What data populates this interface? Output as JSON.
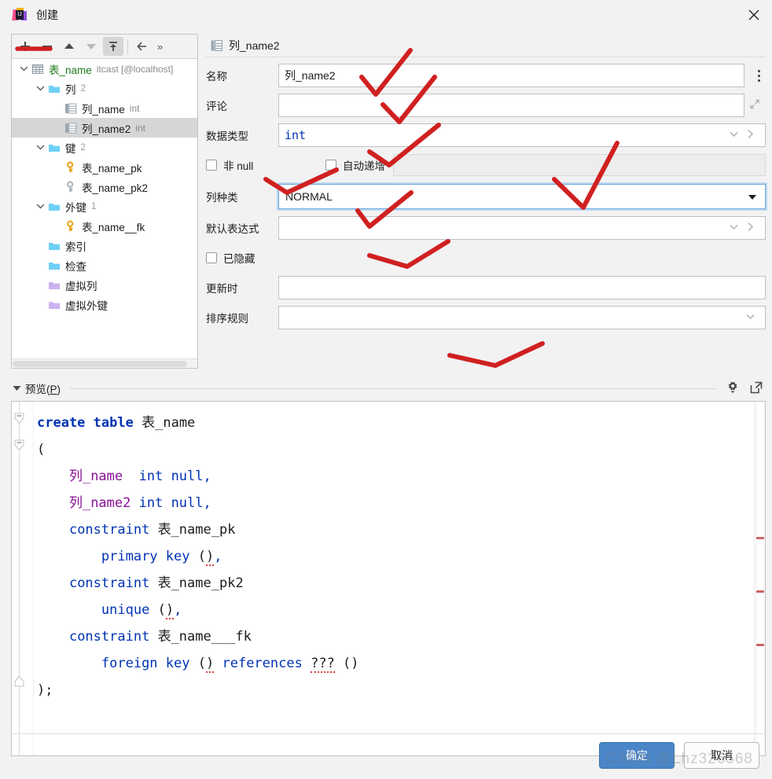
{
  "window": {
    "title": "创建",
    "app_icon": "intellij-idea-icon",
    "close_icon": "close-icon"
  },
  "tree_toolbar": {
    "buttons": [
      {
        "name": "add-button",
        "icon": "plus-icon",
        "label": "+"
      },
      {
        "name": "remove-button",
        "icon": "minus-icon",
        "label": "−"
      },
      {
        "name": "move-up-button",
        "icon": "arrow-up-icon",
        "label": "▲"
      },
      {
        "name": "move-down-button",
        "icon": "arrow-down-icon",
        "label": "▼"
      },
      {
        "name": "move-to-top-button",
        "icon": "upload-icon",
        "label": "⤒",
        "active": true
      },
      {
        "name": "back-button",
        "icon": "arrow-left-icon",
        "label": "←"
      }
    ],
    "overflow_label": "»"
  },
  "tree": {
    "items": [
      {
        "label": "表_name",
        "suffix": "itcast [@localhost]",
        "icon": "table-icon",
        "depth": 0,
        "expanded": true,
        "selected": false,
        "color": "green"
      },
      {
        "label": "列",
        "count": "2",
        "icon": "folder-blue-icon",
        "depth": 1,
        "expanded": true,
        "selected": false,
        "color": "dark"
      },
      {
        "label": "列_name",
        "suffix": "int",
        "icon": "column-icon",
        "depth": 2,
        "expanded": null,
        "selected": false,
        "color": "dark"
      },
      {
        "label": "列_name2",
        "suffix": "int",
        "icon": "column-icon",
        "depth": 2,
        "expanded": null,
        "selected": true,
        "color": "dark"
      },
      {
        "label": "键",
        "count": "2",
        "icon": "folder-blue-icon",
        "depth": 1,
        "expanded": true,
        "selected": false,
        "color": "dark"
      },
      {
        "label": "表_name_pk",
        "icon": "key-gold-icon",
        "depth": 2,
        "expanded": null,
        "selected": false,
        "color": "dark"
      },
      {
        "label": "表_name_pk2",
        "icon": "key-gray-icon",
        "depth": 2,
        "expanded": null,
        "selected": false,
        "color": "dark"
      },
      {
        "label": "外键",
        "count": "1",
        "icon": "folder-blue-icon",
        "depth": 1,
        "expanded": true,
        "selected": false,
        "color": "dark"
      },
      {
        "label": "表_name__fk",
        "icon": "key-gold-icon",
        "depth": 2,
        "expanded": null,
        "selected": false,
        "color": "dark"
      },
      {
        "label": "索引",
        "icon": "folder-blue-icon",
        "depth": 1,
        "expanded": null,
        "selected": false,
        "color": "dark"
      },
      {
        "label": "检查",
        "icon": "folder-blue-icon",
        "depth": 1,
        "expanded": null,
        "selected": false,
        "color": "dark"
      },
      {
        "label": "虚拟列",
        "icon": "folder-purple-icon",
        "depth": 1,
        "expanded": null,
        "selected": false,
        "color": "dark"
      },
      {
        "label": "虚拟外键",
        "icon": "folder-purple-icon",
        "depth": 1,
        "expanded": null,
        "selected": false,
        "color": "dark"
      }
    ]
  },
  "form": {
    "header_title": "列_name2",
    "header_icon": "column-icon",
    "name": {
      "label": "名称",
      "value": "列_name2",
      "kebab_icon": "more-vertical-icon"
    },
    "comment": {
      "label": "评论",
      "value": "",
      "expand_icon": "expand-diagonal-icon"
    },
    "data_type": {
      "label": "数据类型",
      "value": "int",
      "chevron_down_icon": "chevron-down-icon",
      "chevron_right_icon": "chevron-right-icon"
    },
    "not_null": {
      "label": "非 null",
      "checked": false
    },
    "auto_increment": {
      "label": "自动递增",
      "checked": false,
      "value": ""
    },
    "column_kind": {
      "label": "列种类",
      "value": "NORMAL",
      "focused": true,
      "arrow_icon": "triangle-down-icon"
    },
    "default_expression": {
      "label": "默认表达式",
      "value": "",
      "chevron_down_icon": "chevron-down-icon",
      "chevron_right_icon": "chevron-right-icon"
    },
    "hidden": {
      "label": "已隐藏",
      "checked": false
    },
    "on_update": {
      "label": "更新时",
      "value": ""
    },
    "collation": {
      "label": "排序规则",
      "value": "",
      "chevron_down_icon": "chevron-down-icon"
    }
  },
  "preview": {
    "title_prefix": "预览(",
    "mnemonic": "P",
    "title_suffix": ")",
    "twisty_icon": "triangle-down-icon",
    "settings_icon": "gear-icon",
    "popout_icon": "external-link-icon",
    "sql_lines": [
      [
        {
          "t": "create",
          "c": "k"
        },
        {
          "t": " ",
          "c": "p"
        },
        {
          "t": "table",
          "c": "k"
        },
        {
          "t": " ",
          "c": "p"
        },
        {
          "t": "表_name",
          "c": "id"
        }
      ],
      [
        {
          "t": "(",
          "c": "id"
        }
      ],
      [
        {
          "t": "    ",
          "c": "p"
        },
        {
          "t": "列_name",
          "c": "col"
        },
        {
          "t": "  ",
          "c": "p"
        },
        {
          "t": "int null",
          "c": "kw"
        },
        {
          "t": ",",
          "c": "kw"
        }
      ],
      [
        {
          "t": "    ",
          "c": "p"
        },
        {
          "t": "列_name2",
          "c": "col"
        },
        {
          "t": " ",
          "c": "p"
        },
        {
          "t": "int null",
          "c": "kw"
        },
        {
          "t": ",",
          "c": "kw"
        }
      ],
      [
        {
          "t": "    ",
          "c": "p"
        },
        {
          "t": "constraint",
          "c": "kw"
        },
        {
          "t": " ",
          "c": "p"
        },
        {
          "t": "表_name_pk",
          "c": "id"
        }
      ],
      [
        {
          "t": "        ",
          "c": "p"
        },
        {
          "t": "primary key",
          "c": "kw"
        },
        {
          "t": " ",
          "c": "p"
        },
        {
          "t": "(",
          "c": "id"
        },
        {
          "t": ")",
          "c": "err"
        },
        {
          "t": ",",
          "c": "kw"
        }
      ],
      [
        {
          "t": "    ",
          "c": "p"
        },
        {
          "t": "constraint",
          "c": "kw"
        },
        {
          "t": " ",
          "c": "p"
        },
        {
          "t": "表_name_pk2",
          "c": "id"
        }
      ],
      [
        {
          "t": "        ",
          "c": "p"
        },
        {
          "t": "unique",
          "c": "kw"
        },
        {
          "t": " ",
          "c": "p"
        },
        {
          "t": "(",
          "c": "id"
        },
        {
          "t": ")",
          "c": "err"
        },
        {
          "t": ",",
          "c": "kw"
        }
      ],
      [
        {
          "t": "    ",
          "c": "p"
        },
        {
          "t": "constraint",
          "c": "kw"
        },
        {
          "t": " ",
          "c": "p"
        },
        {
          "t": "表_name___fk",
          "c": "id"
        }
      ],
      [
        {
          "t": "        ",
          "c": "p"
        },
        {
          "t": "foreign key",
          "c": "kw"
        },
        {
          "t": " ",
          "c": "p"
        },
        {
          "t": "(",
          "c": "id"
        },
        {
          "t": ")",
          "c": "err"
        },
        {
          "t": " ",
          "c": "p"
        },
        {
          "t": "references",
          "c": "kw"
        },
        {
          "t": " ",
          "c": "p"
        },
        {
          "t": "???",
          "c": "err"
        },
        {
          "t": " ()",
          "c": "id"
        }
      ],
      [
        {
          "t": ");",
          "c": "id"
        }
      ]
    ],
    "sql_plain": "create table 表_name\n(\n    列_name  int null,\n    列_name2 int null,\n    constraint 表_name_pk\n        primary key (),\n    constraint 表_name_pk2\n        unique (),\n    constraint 表_name___fk\n        foreign key () references ??? ()\n);"
  },
  "footer": {
    "ok_label": "确定",
    "cancel_label": "取消"
  },
  "watermark": {
    "text": "CSDN @Lhz326568"
  },
  "colors": {
    "accent": "#4a86c8",
    "focus_border": "#6fa8dc",
    "annotation": "#d02020",
    "keyword": "#0033b3",
    "column": "#871094",
    "table_green": "#1a7a1a"
  }
}
